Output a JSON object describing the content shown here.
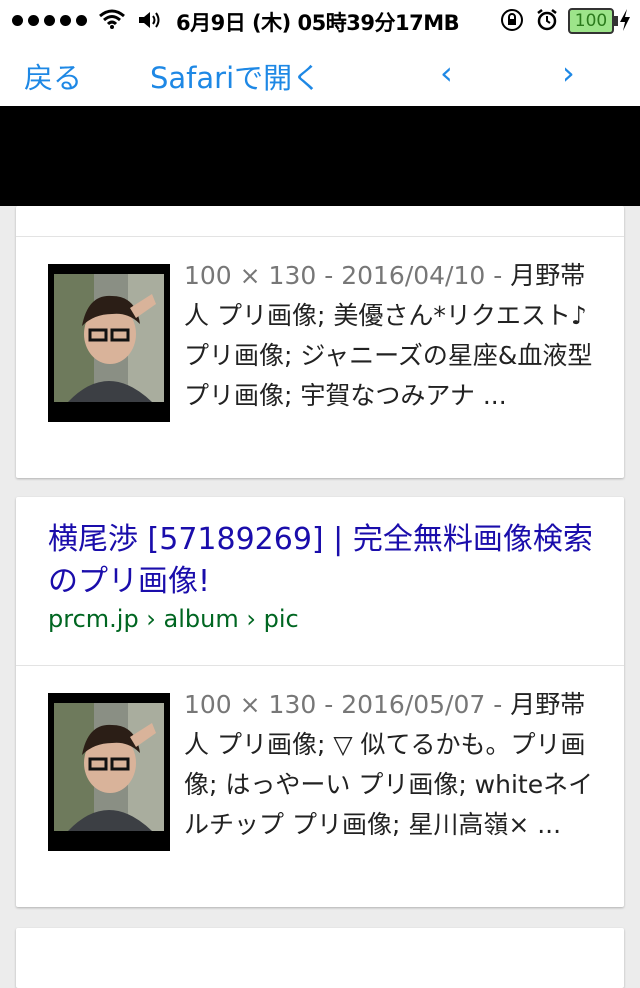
{
  "status_bar": {
    "time": "6月9日 (木) 05時39分17MB",
    "battery": "100"
  },
  "nav": {
    "back": "戻る",
    "open_safari": "Safariで開く",
    "prev": "‹",
    "next": "›"
  },
  "results": [
    {
      "meta": "100 × 130 - 2016/04/10 - ",
      "snippet": "月野帯人 プリ画像; 美優さん*リクエスト♪ プリ画像; ジャニーズの星座&血液型 プリ画像; 宇賀なつみアナ ..."
    },
    {
      "title": "横尾渉 [57189269] | 完全無料画像検索のプリ画像!",
      "url": "prcm.jp › album › pic",
      "meta": "100 × 130 - 2016/05/07 - ",
      "snippet": "月野帯人 プリ画像; ▽ 似てるかも。プリ画像; はっやーい プリ画像; whiteネイルチップ プリ画像; 星川高嶺× ..."
    }
  ],
  "icons": [
    "signal-dots-icon",
    "wifi-icon",
    "volume-icon",
    "lock-rotation-icon",
    "alarm-icon",
    "battery-icon",
    "charging-icon"
  ],
  "colors": {
    "link": "#1a0dab",
    "url": "#006621",
    "nav_accent": "#1e88e5"
  }
}
